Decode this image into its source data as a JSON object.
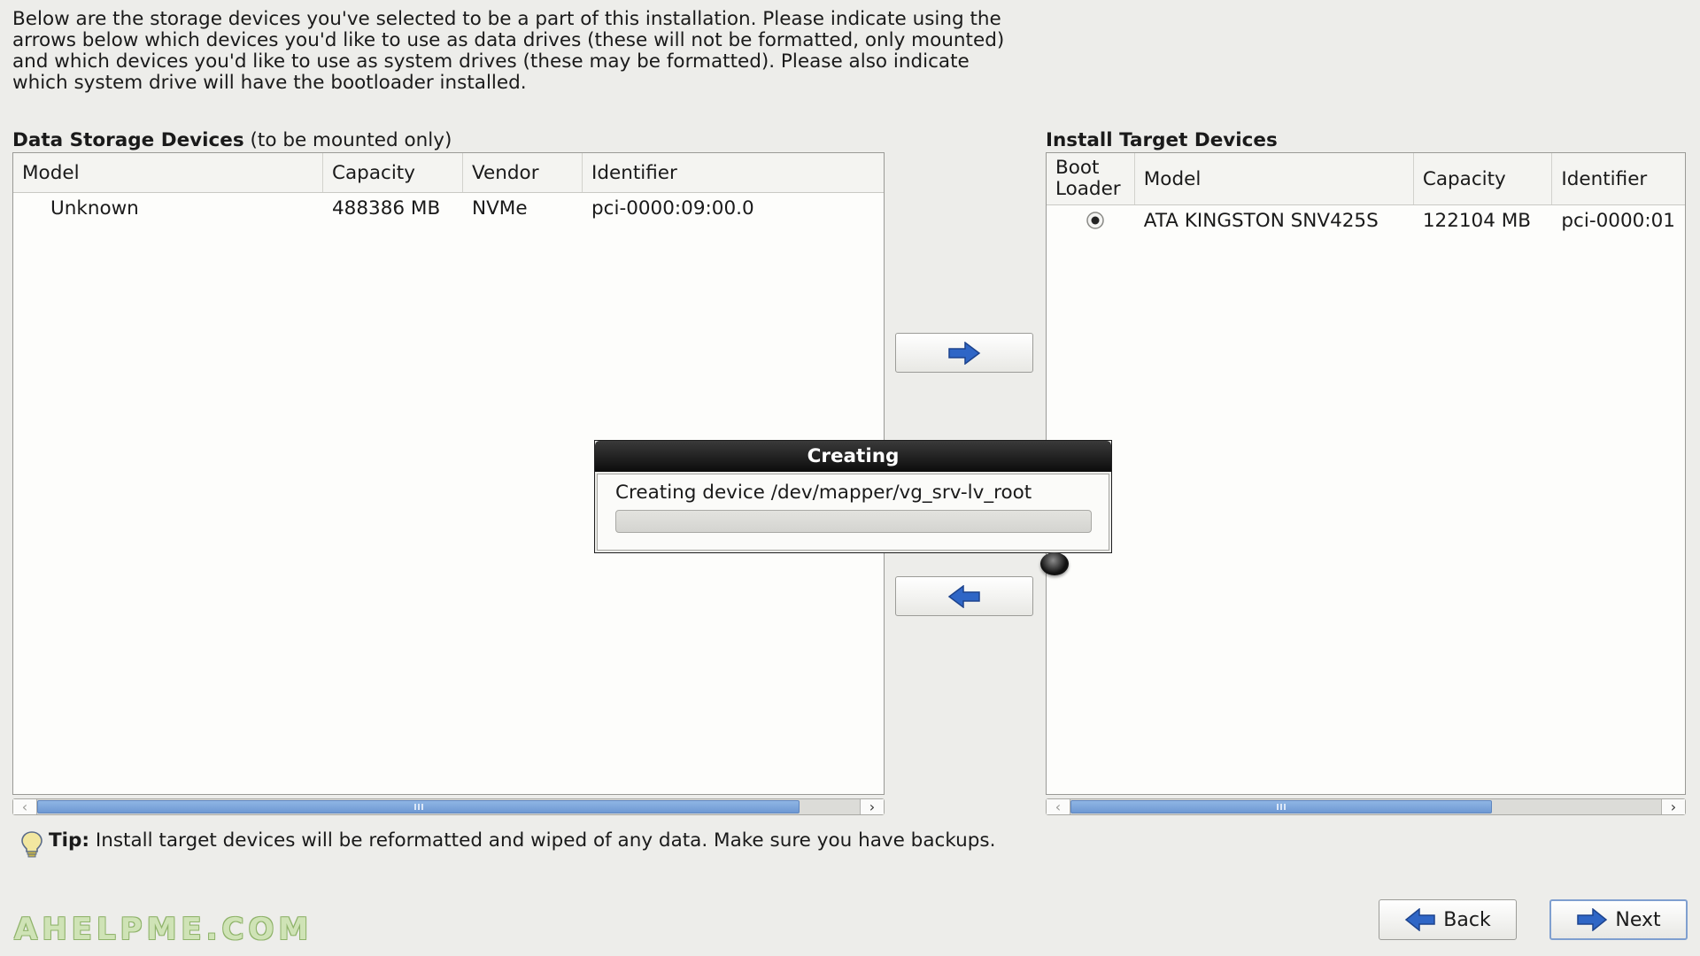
{
  "intro_text": "Below are the storage devices you've selected to be a part of this installation.  Please indicate using the arrows below which devices you'd like to use as data drives (these will not be formatted, only mounted) and which devices you'd like to use as system drives (these may be formatted).  Please also indicate which system drive will have the bootloader installed.",
  "data_panel": {
    "title": "Data Storage Devices",
    "subtitle": "(to be mounted only)",
    "columns": [
      "Model",
      "Capacity",
      "Vendor",
      "Identifier"
    ],
    "rows": [
      {
        "model": "Unknown",
        "capacity": "488386 MB",
        "vendor": "NVMe",
        "identifier": "pci-0000:09:00.0"
      }
    ],
    "scroll_grip": "III"
  },
  "target_panel": {
    "title": "Install Target Devices",
    "columns": [
      "Boot\nLoader",
      "Model",
      "Capacity",
      "Identifier"
    ],
    "rows": [
      {
        "boot_loader_selected": true,
        "model": "ATA KINGSTON SNV425S",
        "capacity": "122104 MB",
        "identifier": "pci-0000:01"
      }
    ],
    "scroll_grip": "III"
  },
  "buttons": {
    "add_icon": "right-arrow-icon",
    "remove_icon": "left-arrow-icon",
    "back_label": "Back",
    "next_label": "Next"
  },
  "dialog": {
    "title": "Creating",
    "message": "Creating device /dev/mapper/vg_srv-lv_root",
    "progress": 0
  },
  "tip": {
    "label": "Tip:",
    "text": "Install target devices will be reformatted and wiped of any data.  Make sure you have backups."
  },
  "watermark": "AHELPME.COM",
  "colors": {
    "accent": "#2f66c6",
    "background": "#ededea",
    "dialog_title_bg": "#111111"
  }
}
